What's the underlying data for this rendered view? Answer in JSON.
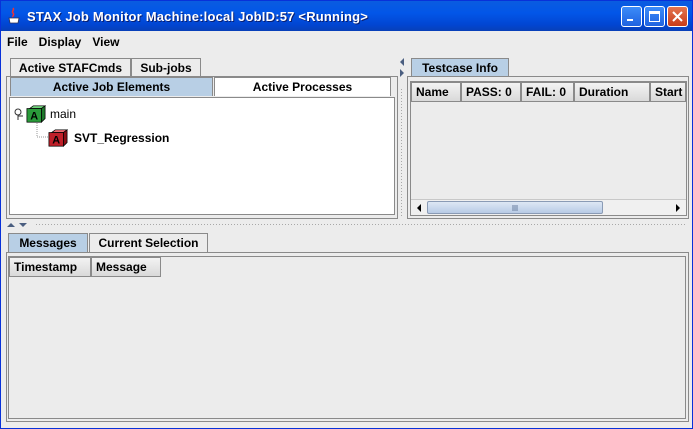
{
  "window": {
    "title": "STAX Job Monitor Machine:local JobID:57  <Running>"
  },
  "menu": [
    "File",
    "Display",
    "View"
  ],
  "left_top": {
    "outer_tabs": [
      "Active STAFCmds",
      "Sub-jobs"
    ],
    "inner_tabs": [
      "Active Job Elements",
      "Active Processes"
    ],
    "tree": {
      "root_label": "main",
      "child_label": "SVT_Regression",
      "cube_letter": "A"
    }
  },
  "right_top": {
    "tab": "Testcase Info",
    "columns": [
      "Name",
      "PASS: 0",
      "FAIL: 0",
      "Duration",
      "Start"
    ]
  },
  "bottom": {
    "tabs": [
      "Messages",
      "Current Selection"
    ],
    "columns": [
      "Timestamp",
      "Message"
    ]
  },
  "colors": {
    "titlebar": "#0256e8",
    "selected_tab": "#b8cfe5",
    "green_cube": "#2a9a3a",
    "red_cube": "#c0202a"
  }
}
